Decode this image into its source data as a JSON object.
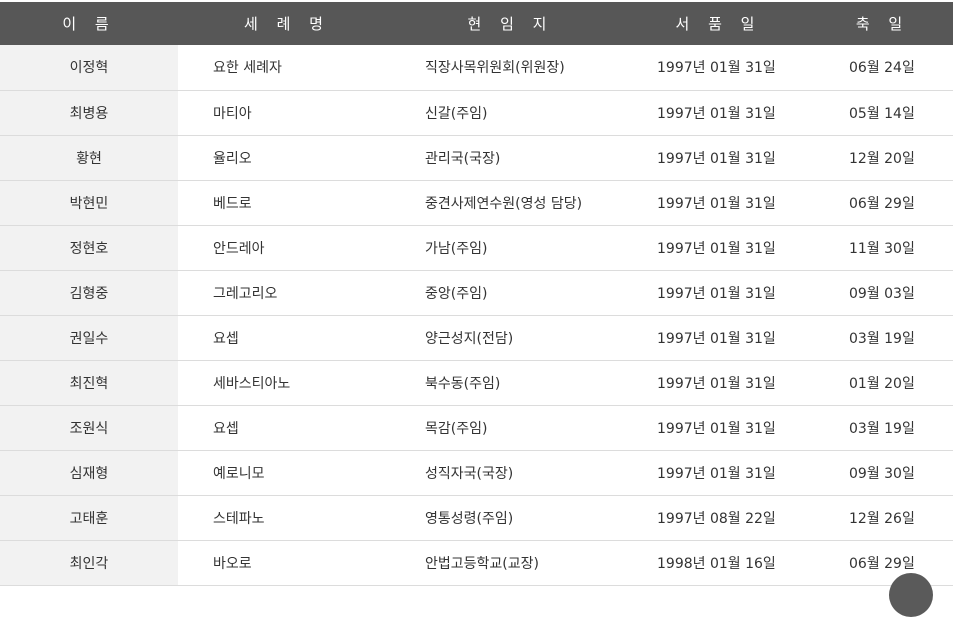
{
  "headers": {
    "name": "이 름",
    "baptismal_name": "세 례 명",
    "position": "현 임 지",
    "ordination": "서 품 일",
    "feast_day": "축 일"
  },
  "rows": [
    {
      "name": "이정혁",
      "baptismal_name": "요한 세례자",
      "position": "직장사목위원회(위원장)",
      "ordination": "1997년 01월 31일",
      "feast_day": "06월 24일"
    },
    {
      "name": "최병용",
      "baptismal_name": "마티아",
      "position": "신갈(주임)",
      "ordination": "1997년 01월 31일",
      "feast_day": "05월 14일"
    },
    {
      "name": "황현",
      "baptismal_name": "율리오",
      "position": "관리국(국장)",
      "ordination": "1997년 01월 31일",
      "feast_day": "12월 20일"
    },
    {
      "name": "박현민",
      "baptismal_name": "베드로",
      "position": "중견사제연수원(영성 담당)",
      "ordination": "1997년 01월 31일",
      "feast_day": "06월 29일"
    },
    {
      "name": "정현호",
      "baptismal_name": "안드레아",
      "position": "가남(주임)",
      "ordination": "1997년 01월 31일",
      "feast_day": "11월 30일"
    },
    {
      "name": "김형중",
      "baptismal_name": "그레고리오",
      "position": "중앙(주임)",
      "ordination": "1997년 01월 31일",
      "feast_day": "09월 03일"
    },
    {
      "name": "권일수",
      "baptismal_name": "요셉",
      "position": "양근성지(전담)",
      "ordination": "1997년 01월 31일",
      "feast_day": "03월 19일"
    },
    {
      "name": "최진혁",
      "baptismal_name": "세바스티아노",
      "position": "북수동(주임)",
      "ordination": "1997년 01월 31일",
      "feast_day": "01월 20일"
    },
    {
      "name": "조원식",
      "baptismal_name": "요셉",
      "position": "목감(주임)",
      "ordination": "1997년 01월 31일",
      "feast_day": "03월 19일"
    },
    {
      "name": "심재형",
      "baptismal_name": "예로니모",
      "position": "성직자국(국장)",
      "ordination": "1997년 01월 31일",
      "feast_day": "09월 30일"
    },
    {
      "name": "고태훈",
      "baptismal_name": "스테파노",
      "position": "영통성령(주임)",
      "ordination": "1997년 08월 22일",
      "feast_day": "12월 26일"
    },
    {
      "name": "최인각",
      "baptismal_name": "바오로",
      "position": "안법고등학교(교장)",
      "ordination": "1998년 01월 16일",
      "feast_day": "06월 29일"
    }
  ]
}
